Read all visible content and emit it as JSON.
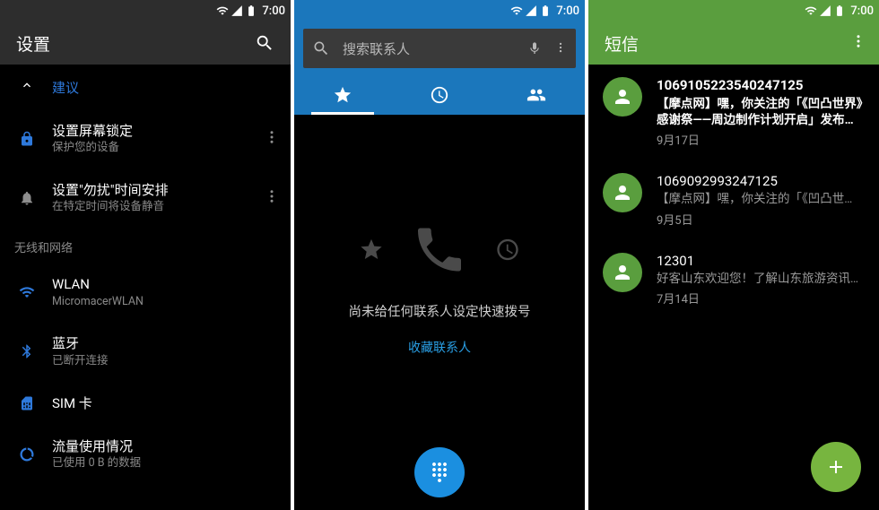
{
  "status": {
    "time": "7:00"
  },
  "settings": {
    "title": "设置",
    "suggestion_label": "建议",
    "suggestions": [
      {
        "title": "设置屏幕锁定",
        "subtitle": "保护您的设备"
      },
      {
        "title": "设置\"勿扰\"时间安排",
        "subtitle": "在特定时间将设备静音"
      }
    ],
    "section1": "无线和网络",
    "items": [
      {
        "title": "WLAN",
        "subtitle": "MicromacerWLAN"
      },
      {
        "title": "蓝牙",
        "subtitle": "已断开连接"
      },
      {
        "title": "SIM 卡",
        "subtitle": ""
      },
      {
        "title": "流量使用情况",
        "subtitle": "已使用 0 B 的数据"
      }
    ]
  },
  "dialer": {
    "search_placeholder": "搜索联系人",
    "empty_message": "尚未给任何联系人设定快速拨号",
    "favorite_link": "收藏联系人"
  },
  "sms": {
    "title": "短信",
    "threads": [
      {
        "sender": "1069105223540247125",
        "preview": "【摩点网】嘿，你关注的「《凹凸世界》感谢祭——周边制作计划开启」发布了更新。打开摩点App，查看项目…",
        "date": "9月17日",
        "unread": true
      },
      {
        "sender": "1069092993247125",
        "preview": "【摩点网】嘿，你关注的「《凹凸世…",
        "date": "9月5日",
        "unread": false
      },
      {
        "sender": "12301",
        "preview": "好客山东欢迎您！了解山东旅游资讯…",
        "date": "7月14日",
        "unread": false
      }
    ]
  }
}
